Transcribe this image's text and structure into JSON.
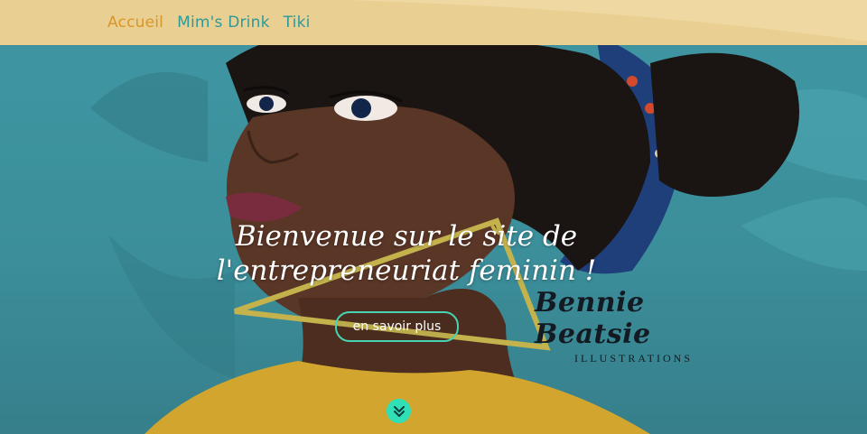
{
  "nav": {
    "items": [
      {
        "label": "Accueil",
        "active": true
      },
      {
        "label": "Mim's Drink",
        "active": false
      },
      {
        "label": "Tiki",
        "active": false
      }
    ]
  },
  "hero": {
    "headline": "Bienvenue sur le site de l'entrepreneuriat feminin !",
    "cta_label": "en savoir plus"
  },
  "signature": {
    "name": "Bennie Beatsie",
    "subtitle": "ILLUSTRATIONS"
  },
  "icons": {
    "scroll_down": "double-chevron-down-icon"
  },
  "colors": {
    "navbar": "#e9cf91",
    "nav_active": "#d9962a",
    "nav_link": "#2d9a99",
    "hero_bg": "#3b8e9a",
    "accent": "#2fe0b7"
  }
}
